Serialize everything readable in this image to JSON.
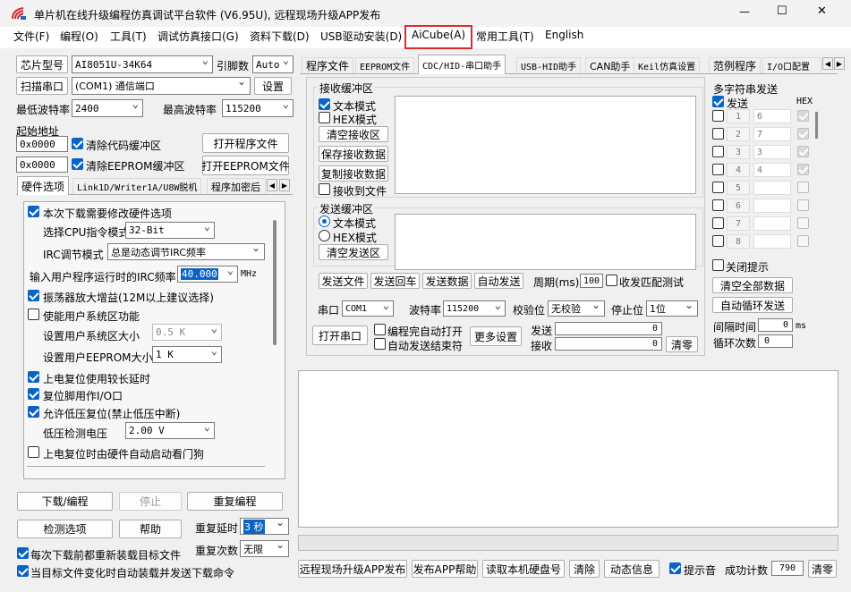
{
  "window": {
    "title": "单片机在线升级编程仿真调试平台软件 (V6.95U), 远程现场升级APP发布",
    "min": "—",
    "max": "☐",
    "close": "✕"
  },
  "menu": [
    "文件(F)",
    "编程(O)",
    "工具(T)",
    "调试仿真接口(G)",
    "资料下载(D)",
    "USB驱动安装(D)",
    "AiCube(A)",
    "常用工具(T)",
    "English"
  ],
  "left": {
    "chip_btn": "芯片型号",
    "chip_val": "AI8051U-34K64",
    "pins_lbl": "引脚数",
    "pins_val": "Auto",
    "scan_btn": "扫描串口",
    "port_val": "(COM1) 通信端口",
    "settings_btn": "设置",
    "minbaud_lbl": "最低波特率",
    "minbaud_val": "2400",
    "maxbaud_lbl": "最高波特率",
    "maxbaud_val": "115200",
    "start_lbl": "起始地址",
    "addr1": "0x0000",
    "clear_code": "清除代码缓冲区",
    "open_prog": "打开程序文件",
    "addr2": "0x0000",
    "clear_eeprom": "清除EEPROM缓冲区",
    "open_eeprom": "打开EEPROM文件",
    "tabs": [
      "硬件选项",
      "Link1D/Writer1A/U8W脱机",
      "程序加密后"
    ],
    "opt_reload": "本次下载需要修改硬件选项",
    "cpu_lbl": "选择CPU指令模式",
    "cpu_val": "32-Bit",
    "irc_lbl": "IRC调节模式",
    "irc_val": "总是动态调节IRC频率",
    "freq_lbl": "输入用户程序运行时的IRC频率",
    "freq_val": "40.000",
    "freq_unit": "MHz",
    "osc_gain": "振荡器放大增益(12M以上建议选择)",
    "user_sys": "使能用户系统区功能",
    "user_sys_size_lbl": "设置用户系统区大小",
    "user_sys_size_val": "0.5 K",
    "user_eeprom_lbl": "设置用户EEPROM大小",
    "user_eeprom_val": "1   K",
    "long_reset": "上电复位使用较长延时",
    "reset_io": "复位脚用作I/O口",
    "lvd_reset": "允许低压复位(禁止低压中断)",
    "lvd_lbl": "低压检测电压",
    "lvd_val": "2.00 V",
    "wdt": "上电复位时由硬件自动启动看门狗",
    "download": "下载/编程",
    "stop": "停止",
    "repeat_prog": "重复编程",
    "check": "检测选项",
    "help": "帮助",
    "repeat_delay_lbl": "重复延时",
    "repeat_delay_val": "3 秒",
    "repeat_times_lbl": "重复次数",
    "repeat_times_val": "无限",
    "reload_each": "每次下载前都重新装载目标文件",
    "auto_on_change": "当目标文件变化时自动装载并发送下载命令"
  },
  "right": {
    "tabs": [
      "程序文件",
      "EEPROM文件",
      "CDC/HID-串口助手",
      "USB-HID助手",
      "CAN助手",
      "Keil仿真设置",
      "范例程序",
      "I/O口配置"
    ],
    "recv_group": "接收缓冲区",
    "text_mode": "文本模式",
    "hex_mode": "HEX模式",
    "clear_recv": "清空接收区",
    "save_recv": "保存接收数据",
    "copy_recv": "复制接收数据",
    "recv_to_file": "接收到文件",
    "send_group": "发送缓冲区",
    "send_text_mode": "文本模式",
    "send_hex_mode": "HEX模式",
    "clear_send": "清空发送区",
    "send_file": "发送文件",
    "send_back": "发送回车",
    "send_data": "发送数据",
    "auto_send": "自动发送",
    "period_lbl": "周期(ms)",
    "period_val": "100",
    "match_test": "收发匹配测试",
    "port_lbl": "串口",
    "port_val": "COM1",
    "baud_lbl": "波特率",
    "baud_val": "115200",
    "parity_lbl": "校验位",
    "parity_val": "无校验",
    "stop_lbl": "停止位",
    "stop_val": "1位",
    "open_port": "打开串口",
    "auto_open": "编程完自动打开",
    "auto_end": "自动发送结束符",
    "more": "更多设置",
    "send_cnt_lbl": "发送",
    "send_cnt": "0",
    "recv_cnt_lbl": "接收",
    "recv_cnt": "0",
    "clear_cnt": "清零",
    "multi_title": "多字符串发送",
    "send_col": "发送",
    "hex_col": "HEX",
    "rows": [
      {
        "n": "1",
        "v": "6"
      },
      {
        "n": "2",
        "v": "7"
      },
      {
        "n": "3",
        "v": "3"
      },
      {
        "n": "4",
        "v": "4"
      },
      {
        "n": "5",
        "v": ""
      },
      {
        "n": "6",
        "v": ""
      },
      {
        "n": "7",
        "v": ""
      },
      {
        "n": "8",
        "v": ""
      }
    ],
    "close_hint": "关闭提示",
    "clear_all": "清空全部数据",
    "auto_loop": "自动循环发送",
    "interval_lbl": "间隔时间",
    "interval_val": "0",
    "interval_unit": "ms",
    "loop_lbl": "循环次数",
    "loop_val": "0",
    "publish_app": "远程现场升级APP发布",
    "publish_help": "发布APP帮助",
    "read_serial": "读取本机硬盘号",
    "clear": "清除",
    "dyn_info": "动态信息",
    "beep": "提示音",
    "success_lbl": "成功计数",
    "success_val": "790",
    "clear2": "清零"
  },
  "colors": {
    "accent": "#0a64c8",
    "highlight": "#e0292d"
  }
}
